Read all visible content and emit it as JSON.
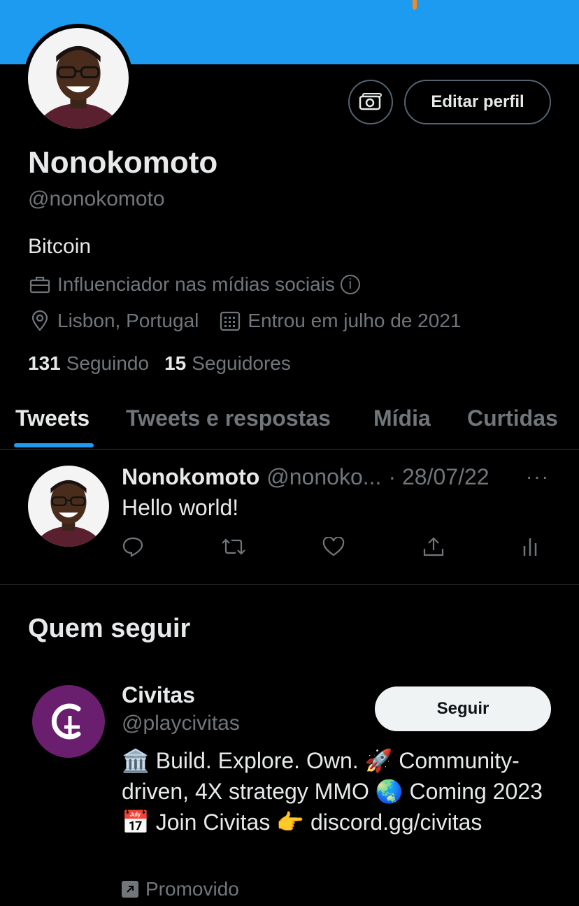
{
  "colors": {
    "accent": "#1d9bf0",
    "background": "#000000",
    "muted": "#71767b",
    "text": "#e7e9ea",
    "promo_logo": "#6a1f6e"
  },
  "profile": {
    "name": "Nonokomoto",
    "handle": "@nonokomoto",
    "bio": "Bitcoin",
    "category": "Influenciador nas mídias sociais",
    "location": "Lisbon, Portugal",
    "joined": "Entrou em julho de 2021",
    "following_count": "131",
    "following_label": "Seguindo",
    "followers_count": "15",
    "followers_label": "Seguidores"
  },
  "actions": {
    "edit_label": "Editar perfil"
  },
  "tabs": [
    {
      "label": "Tweets",
      "active": true
    },
    {
      "label": "Tweets e respostas",
      "active": false
    },
    {
      "label": "Mídia",
      "active": false
    },
    {
      "label": "Curtidas",
      "active": false
    }
  ],
  "tweet": {
    "name": "Nonokomoto",
    "handle": "@nonoko...",
    "date": "· 28/07/22",
    "more": "···",
    "text": "Hello world!"
  },
  "who_to_follow": {
    "title": "Quem seguir",
    "account": {
      "name": "Civitas",
      "handle": "@playcivitas",
      "follow_label": "Seguir",
      "description": "🏛️ Build. Explore. Own. 🚀 Community-driven, 4X strategy MMO 🌏 Coming 2023 📅 Join Civitas 👉 discord.gg/civitas",
      "promoted_label": "Promovido"
    }
  }
}
